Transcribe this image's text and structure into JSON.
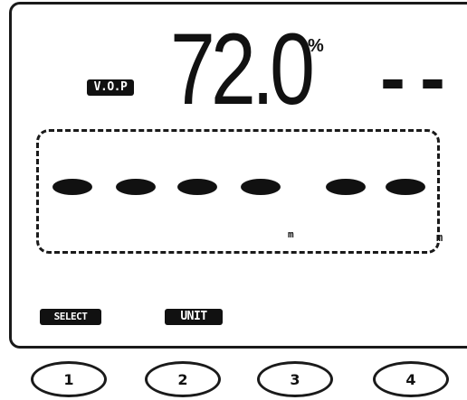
{
  "display": {
    "vop_label": "V.O.P",
    "main_value": "72.0",
    "main_unit": "%",
    "secondary_value": "--",
    "segments": [
      "segment",
      "segment",
      "segment",
      "segment",
      "segment",
      "segment"
    ],
    "inner_unit_label": "m",
    "edge_unit_label": "m"
  },
  "softkeys": {
    "select_label": "SELECT",
    "unit_label": "UNIT"
  },
  "keys": [
    {
      "label": "1"
    },
    {
      "label": "2"
    },
    {
      "label": "3"
    },
    {
      "label": "4"
    }
  ]
}
